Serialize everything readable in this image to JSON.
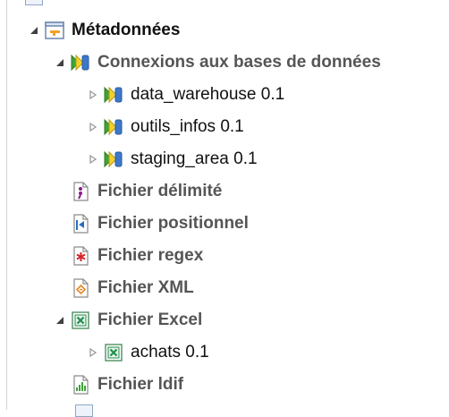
{
  "tree": {
    "metadata": {
      "label": "Métadonnées",
      "icon": "metadata-folder-icon",
      "expanded": true
    },
    "db_connections": {
      "label": "Connexions aux bases de données",
      "icon": "db-connection-icon",
      "expanded": true,
      "children": [
        {
          "label": "data_warehouse 0.1",
          "icon": "db-connection-icon",
          "expanded": false
        },
        {
          "label": "outils_infos 0.1",
          "icon": "db-connection-icon",
          "expanded": false
        },
        {
          "label": "staging_area 0.1",
          "icon": "db-connection-icon",
          "expanded": false
        }
      ]
    },
    "delimited_file": {
      "label": "Fichier délimité",
      "icon": "delimited-file-icon"
    },
    "positional_file": {
      "label": "Fichier positionnel",
      "icon": "positional-file-icon"
    },
    "regex_file": {
      "label": "Fichier regex",
      "icon": "regex-file-icon"
    },
    "xml_file": {
      "label": "Fichier XML",
      "icon": "xml-file-icon"
    },
    "excel_file": {
      "label": "Fichier Excel",
      "icon": "excel-file-icon",
      "expanded": true,
      "children": [
        {
          "label": "achats 0.1",
          "icon": "excel-file-icon",
          "expanded": false
        }
      ]
    },
    "ldif_file": {
      "label": "Fichier ldif",
      "icon": "ldif-file-icon"
    }
  },
  "colors": {
    "toggle_expanded": "#404040",
    "toggle_collapsed": "#9a9a9a",
    "db_green": "#3fa534",
    "db_yellow": "#f3d12d",
    "db_blue": "#3d78c9",
    "excel_green": "#1f8f4c",
    "metadata_orange": "#f2a12b"
  }
}
